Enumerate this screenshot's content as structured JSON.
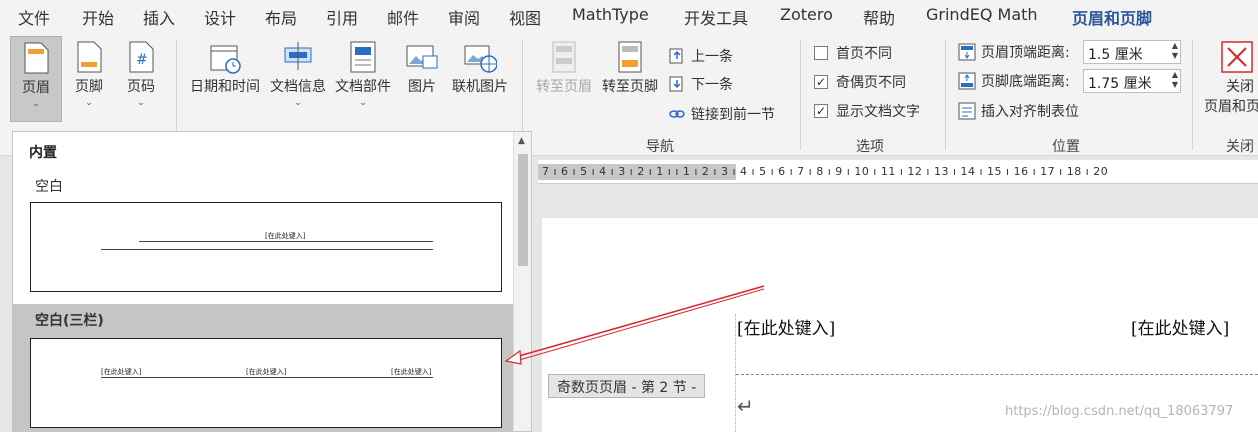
{
  "menu": {
    "tabs": [
      "文件",
      "开始",
      "插入",
      "设计",
      "布局",
      "引用",
      "邮件",
      "审阅",
      "视图",
      "MathType",
      "开发工具",
      "Zotero",
      "帮助",
      "GrindEQ Math",
      "页眉和页脚"
    ]
  },
  "ribbon": {
    "header_btn": "页眉",
    "footer_btn": "页脚",
    "page_number_btn": "页码",
    "datetime_btn": "日期和时间",
    "docinfo_btn": "文档信息",
    "docparts_btn": "文档部件",
    "picture_btn": "图片",
    "online_picture_btn": "联机图片",
    "goto_header_btn": "转至页眉",
    "goto_footer_btn": "转至页脚",
    "prev_btn": "上一条",
    "next_btn": "下一条",
    "link_prev_btn": "链接到前一节",
    "nav_group": "导航",
    "diff_first_page": "首页不同",
    "diff_odd_even": "奇偶页不同",
    "show_doc_text": "显示文档文字",
    "options_group": "选项",
    "header_top_label": "页眉顶端距离:",
    "header_top_value": "1.5 厘米",
    "footer_bottom_label": "页脚底端距离:",
    "footer_bottom_value": "1.75 厘米",
    "insert_align_tab": "插入对齐制表位",
    "position_group": "位置",
    "close_btn_line1": "关闭",
    "close_btn_line2": "页眉和页",
    "close_group": "关闭",
    "checks": {
      "diff_first_page": false,
      "diff_odd_even": true,
      "show_doc_text": true
    }
  },
  "gallery": {
    "section": "内置",
    "item1_title": "空白",
    "item1_placeholder": "[在此处键入]",
    "item2_title": "空白(三栏)",
    "item2_placeholders": [
      "[在此处键入]",
      "[在此处键入]",
      "[在此处键入]"
    ]
  },
  "ruler": {
    "text": "7 ı 6 ı 5 ı 4 ı 3 ı 2 ı 1 ı   ı 1 ı 2 ı 3 ı 4 ı 5 ı 6 ı 7 ı 8 ı 9 ı 10 ı 11 ı 12 ı 13 ı 14 ı 15 ı 16 ı 17 ı 18 ı 20"
  },
  "document": {
    "left_placeholder": "[在此处键入]",
    "right_placeholder": "[在此处键入]",
    "header_tag": "奇数页页眉 - 第 2 节 -",
    "return_mark": "↵",
    "watermark": "https://blog.csdn.net/qq_18063797"
  },
  "colors": {
    "accent": "#2b579a",
    "arrow": "#d9262c"
  }
}
